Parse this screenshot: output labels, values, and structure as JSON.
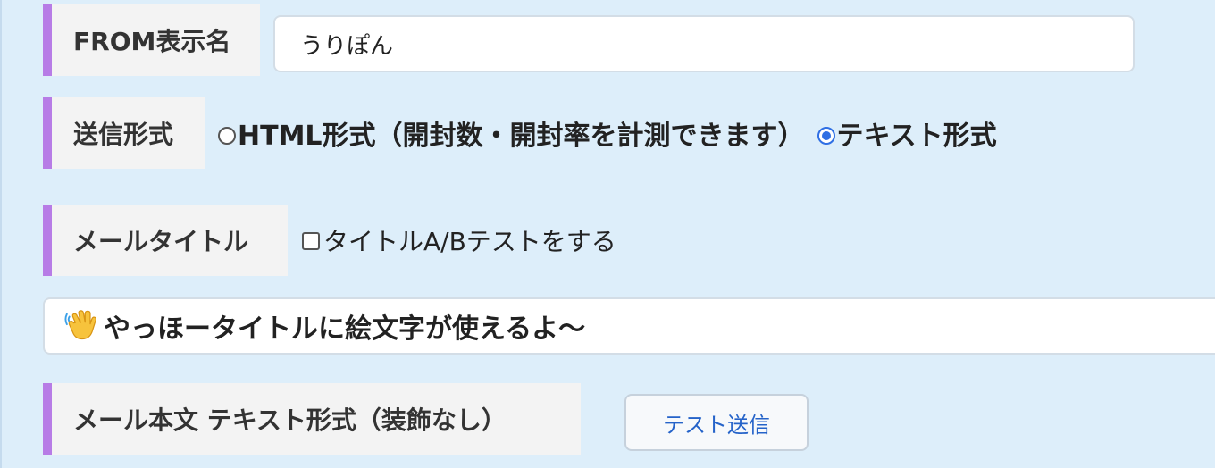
{
  "from_display_name": {
    "label": "FROM表示名",
    "value": "うりぽん"
  },
  "send_format": {
    "label": "送信形式",
    "options": [
      {
        "label": "HTML形式（開封数・開封率を計測できます）",
        "selected": false
      },
      {
        "label": "テキスト形式",
        "selected": true
      }
    ]
  },
  "mail_title": {
    "label": "メールタイトル",
    "ab_test_checkbox_label": "タイトルA/Bテストをする",
    "ab_test_checked": false,
    "emoji_icon": "waving-hand-icon",
    "value": "やっほータイトルに絵文字が使えるよ〜"
  },
  "mail_body": {
    "label": "メール本文 テキスト形式（装飾なし）",
    "test_send_button": "テスト送信"
  },
  "colors": {
    "accent_bar": "#b77ce6",
    "panel_bg": "#ddeefa",
    "radio_selected": "#2f6fe4",
    "button_text": "#2563c9"
  }
}
